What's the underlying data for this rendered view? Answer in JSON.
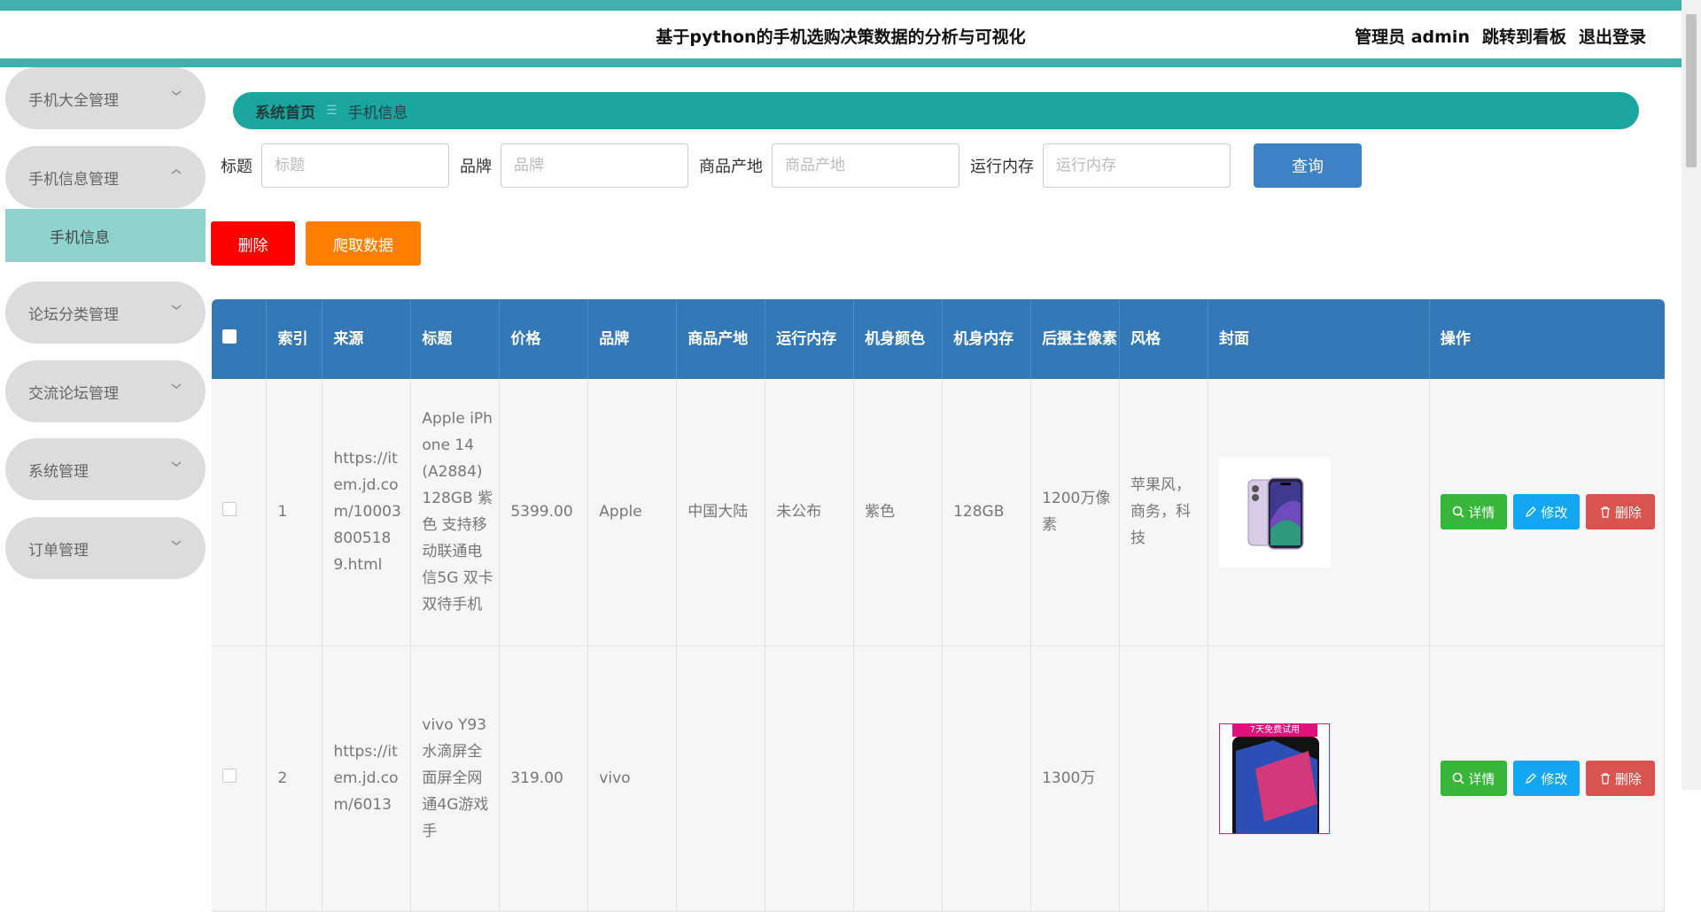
{
  "header": {
    "title": "基于python的手机选购决策数据的分析与可视化",
    "user_label": "管理员 admin",
    "dashboard_link": "跳转到看板",
    "logout_link": "退出登录"
  },
  "sidebar": {
    "items": [
      {
        "label": "手机大全管理"
      },
      {
        "label": "手机信息管理"
      },
      {
        "label": "论坛分类管理"
      },
      {
        "label": "交流论坛管理"
      },
      {
        "label": "系统管理"
      },
      {
        "label": "订单管理"
      }
    ],
    "active_sub": "手机信息"
  },
  "breadcrumb": {
    "home": "系统首页",
    "separator": "☰",
    "current": "手机信息"
  },
  "search": {
    "title_label": "标题",
    "title_placeholder": "标题",
    "brand_label": "品牌",
    "brand_placeholder": "品牌",
    "origin_label": "商品产地",
    "origin_placeholder": "商品产地",
    "ram_label": "运行内存",
    "ram_placeholder": "运行内存",
    "query_button": "查询"
  },
  "actions": {
    "delete_button": "删除",
    "crawl_button": "爬取数据"
  },
  "table": {
    "headers": [
      "索引",
      "来源",
      "标题",
      "价格",
      "品牌",
      "商品产地",
      "运行内存",
      "机身颜色",
      "机身内存",
      "后摄主像素",
      "风格",
      "封面",
      "操作"
    ],
    "rows": [
      {
        "index": "1",
        "source": "https://item.jd.com/100038005189.html",
        "title": "Apple iPhone 14 (A2884) 128GB 紫色 支持移动联通电信5G 双卡双待手机",
        "price": "5399.00",
        "brand": "Apple",
        "origin": "中国大陆",
        "ram": "未公布",
        "color": "紫色",
        "storage": "128GB",
        "camera": "1200万像素",
        "style": "苹果风，商务，科技"
      },
      {
        "index": "2",
        "source": "https://item.jd.com/6013",
        "title": "vivo Y93 水滴屏全面屏全网通4G游戏手",
        "price": "319.00",
        "brand": "vivo",
        "origin": "",
        "ram": "",
        "color": "",
        "storage": "",
        "camera": "1300万",
        "style": "",
        "cover_tag": "7天免费试用"
      }
    ],
    "op_detail": "详情",
    "op_edit": "修改",
    "op_delete": "删除"
  },
  "colors": {
    "teal": "#3fb0aa",
    "breadcrumb_bg": "#1aa59e",
    "table_header": "#3379b8",
    "delete_red": "#ff0000",
    "crawl_orange": "#ff8000",
    "detail_green": "#37b63a",
    "edit_blue": "#13a6f2",
    "row_delete": "#d9534f"
  }
}
